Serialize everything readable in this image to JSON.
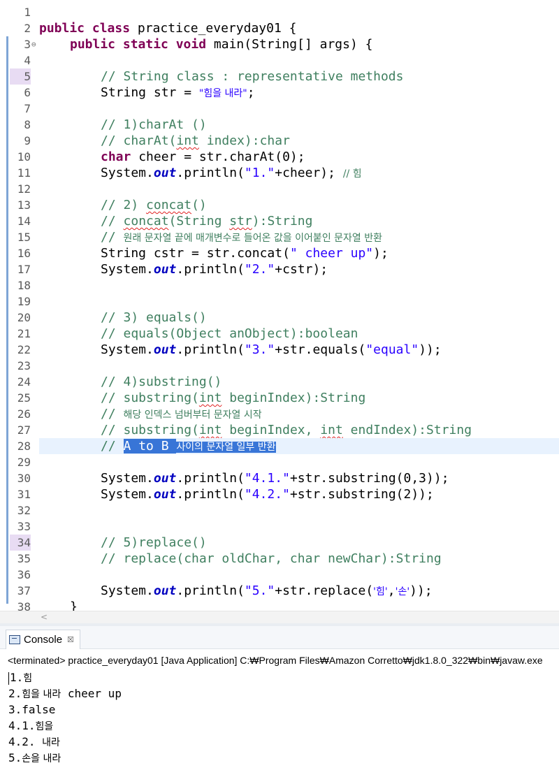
{
  "editor": {
    "line_numbers": [
      "1",
      "2",
      "3",
      "4",
      "5",
      "6",
      "7",
      "8",
      "9",
      "10",
      "11",
      "12",
      "13",
      "14",
      "15",
      "16",
      "17",
      "18",
      "19",
      "20",
      "21",
      "22",
      "23",
      "24",
      "25",
      "26",
      "27",
      "28",
      "29",
      "30",
      "31",
      "32",
      "33",
      "34",
      "35",
      "36",
      "37",
      "38"
    ],
    "code": {
      "l2_kw": "public class",
      "l2_rest": " practice_everyday01 {",
      "l3_kw": "public static void",
      "l3_rest": " main(String[] args) {",
      "l5": "// String class : representative methods",
      "l6_a": "String str = ",
      "l6_str": "\"힘을 내라\"",
      "l6_b": ";",
      "l8": "// 1)charAt ()",
      "l9_a": "// charAt(",
      "l9_sq": "int",
      "l9_b": " index):char",
      "l10_kw": "char",
      "l10_rest": " cheer = str.charAt(0);",
      "l11_a": "System.",
      "l11_fld": "out",
      "l11_b": ".println(",
      "l11_str": "\"1.\"",
      "l11_c": "+cheer); ",
      "l11_cm": "// 힘",
      "l13_a": "// 2) ",
      "l13_sq": "concat",
      "l13_b": "()",
      "l14_a": "// ",
      "l14_sq1": "concat",
      "l14_b": "(String ",
      "l14_sq2": "str",
      "l14_c": "):String",
      "l15_a": "// ",
      "l15_ko": "원래 문자열 끝에 매개변수로 들어온 값을 이어붙인 문자열 반환",
      "l16_a": "String cstr = str.concat(",
      "l16_str": "\" cheer up\"",
      "l16_b": ");",
      "l17_a": "System.",
      "l17_fld": "out",
      "l17_b": ".println(",
      "l17_str": "\"2.\"",
      "l17_c": "+cstr);",
      "l20": "// 3) equals()",
      "l21": "// equals(Object anObject):boolean",
      "l22_a": "System.",
      "l22_fld": "out",
      "l22_b": ".println(",
      "l22_str1": "\"3.\"",
      "l22_c": "+str.equals(",
      "l22_str2": "\"equal\"",
      "l22_d": "));",
      "l24": "// 4)substring()",
      "l25_a": "// substring(",
      "l25_sq": "int",
      "l25_b": " beginIndex):String",
      "l26_a": "// ",
      "l26_ko": "해당 인덱스 넘버부터 문자열 시작",
      "l27_a": "// substring(",
      "l27_sq1": "int",
      "l27_b": " beginIndex, ",
      "l27_sq2": "int",
      "l27_c": " endIndex):String",
      "l28_a": "// ",
      "l28_sel1": "A to B ",
      "l28_sel2": "사이의 문자열 일부 반환",
      "l30_a": "System.",
      "l30_fld": "out",
      "l30_b": ".println(",
      "l30_str": "\"4.1.\"",
      "l30_c": "+str.substring(0,3));",
      "l31_a": "System.",
      "l31_fld": "out",
      "l31_b": ".println(",
      "l31_str": "\"4.2.\"",
      "l31_c": "+str.substring(2));",
      "l34": "// 5)replace()",
      "l35": "// replace(char oldChar, char newChar):String",
      "l37_a": "System.",
      "l37_fld": "out",
      "l37_b": ".println(",
      "l37_str1": "\"5.\"",
      "l37_c": "+str.replace(",
      "l37_str2": "'힘'",
      "l37_d": ",",
      "l37_str3": "'손'",
      "l37_e": "));",
      "l38": "}"
    }
  },
  "scrollbar": {
    "left_arrow": "<"
  },
  "console": {
    "tab_label": "Console",
    "tab_close": "☒",
    "status": "<terminated> practice_everyday01 [Java Application] C:₩Program Files₩Amazon Corretto₩jdk1.8.0_322₩bin₩javaw.exe",
    "output": [
      {
        "prefix": "1.",
        "ko": "힘"
      },
      {
        "prefix": "2.",
        "ko": "힘을 내라",
        "tail": " cheer up"
      },
      {
        "prefix": "3.false",
        "ko": ""
      },
      {
        "prefix": "4.1.",
        "ko": "힘을"
      },
      {
        "prefix": "4.2. ",
        "ko": "내라"
      },
      {
        "prefix": "5.",
        "ko": "손을 내라"
      }
    ]
  }
}
